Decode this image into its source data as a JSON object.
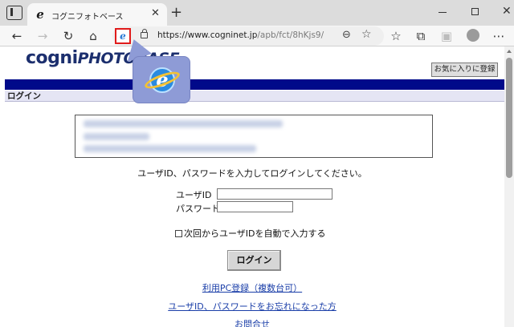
{
  "browser": {
    "tab": {
      "title": "コグニフォトベース",
      "favicon_icon": "ie-e-icon"
    },
    "new_tab_label": "+",
    "address": {
      "url_host": "https://www.cogninet.jp",
      "url_path": "/apb/fct/8hKjs9/"
    },
    "icons": [
      "back-icon",
      "forward-icon",
      "reload-icon",
      "home-icon",
      "ie-mode-icon",
      "lock-icon",
      "zoom-icon",
      "favorite-add-icon",
      "favorites-icon",
      "collections-icon",
      "extensions-icon",
      "profile-icon",
      "more-icon"
    ]
  },
  "page": {
    "logo": {
      "prefix": "cogni",
      "suffix": "PHOTOBASE"
    },
    "favorites_button": "お気に入りに登録",
    "section_header": "ログイン",
    "instruction": "ユーザID、パスワードを入力してログインしてください。",
    "form": {
      "user_label": "ユーザID",
      "password_label": "パスワード",
      "user_value": "",
      "password_value": "",
      "auto_login_label": "次回からユーザIDを自動で入力する",
      "auto_login_checked": false,
      "login_button": "ログイン"
    },
    "links": {
      "register": "利用PC登録（複数台可）",
      "forgot": "ユーザID、パスワードをお忘れになった方",
      "contact": "お問合せ"
    }
  },
  "colors": {
    "band": "#000a8a",
    "header_bg": "#e5e5f4",
    "link": "#1a3ea8",
    "logo": "#1c2f6e",
    "ie_highlight": "#e01b1b",
    "popup_bg": "#8e9bd6"
  }
}
